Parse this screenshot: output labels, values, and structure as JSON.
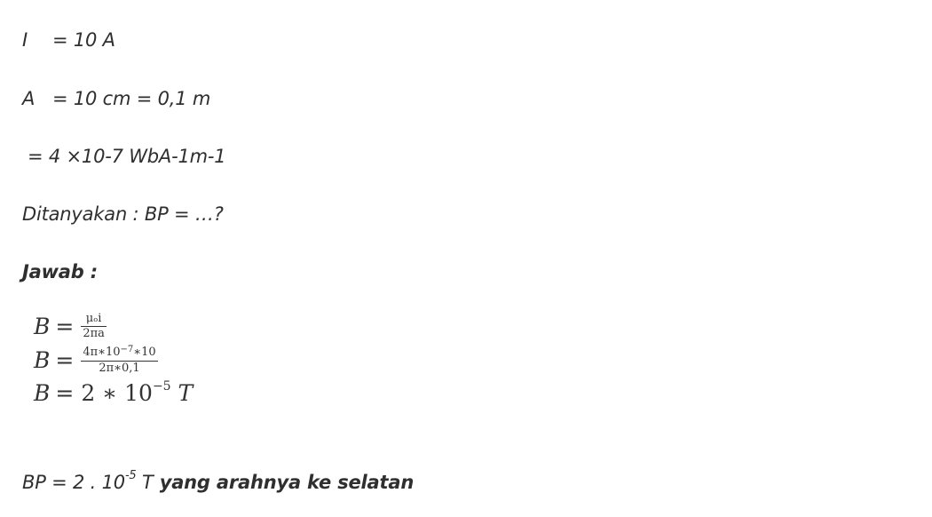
{
  "given": {
    "current": {
      "symbol": "I",
      "eq": "= 10 A"
    },
    "distance": {
      "symbol": "A",
      "eq": "= 10 cm = 0,1 m"
    },
    "mu": {
      "eq": "= 4 ×10-7 WbA-1m-1"
    }
  },
  "question": "Ditanyakan : BP = …?",
  "answer_label": "Jawab :",
  "formula": {
    "lhs": "B",
    "eq_sign": "=",
    "line1": {
      "num": "μₒi",
      "den": "2πa"
    },
    "line2": {
      "num_pre": "4π∗10",
      "num_exp": "−7",
      "num_post": "∗10",
      "den": "2π∗0,1"
    },
    "line3": {
      "base": "2 ∗ 10",
      "exp": "−5",
      "unit": "T"
    }
  },
  "result": {
    "prefix": "BP = 2 . 10",
    "exp": "-5",
    "unit": " T",
    "suffix": " yang arahnya ke selatan"
  }
}
